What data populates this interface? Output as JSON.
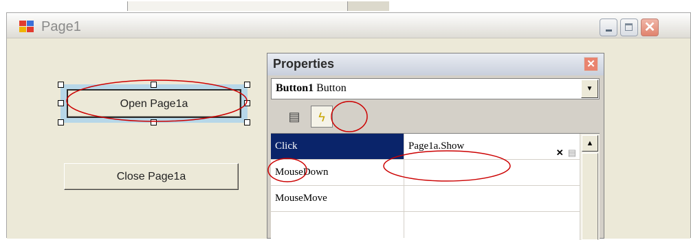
{
  "window": {
    "title": "Page1"
  },
  "form": {
    "open_button_label": "Open Page1a",
    "close_button_label": "Close Page1a"
  },
  "properties": {
    "title": "Properties",
    "object_name": "Button1",
    "object_type": "Button",
    "rows": [
      {
        "name": "Click",
        "value": "Page1a.Show"
      },
      {
        "name": "MouseDown",
        "value": ""
      },
      {
        "name": "MouseMove",
        "value": ""
      }
    ]
  },
  "icons": {
    "properties_tab": "property-page-icon",
    "events_tab": "lightning-bolt-icon"
  },
  "colors": {
    "selected_row": "#0a246a",
    "annotation": "#cc0000",
    "selection_frame": "#b7d7e8"
  }
}
